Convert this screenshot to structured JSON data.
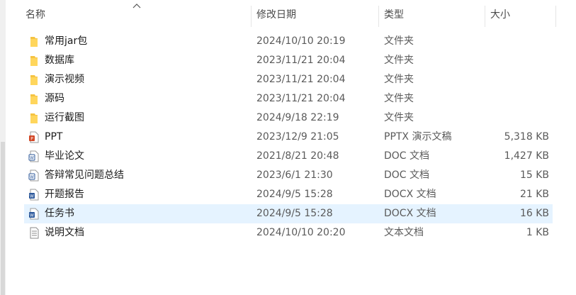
{
  "columns": {
    "name": "名称",
    "modified": "修改日期",
    "type": "类型",
    "size": "大小"
  },
  "files": [
    {
      "name": "常用jar包",
      "modified": "2024/10/10 20:19",
      "type": "文件夹",
      "size": "",
      "icon": "folder-icon"
    },
    {
      "name": "数据库",
      "modified": "2023/11/21 20:04",
      "type": "文件夹",
      "size": "",
      "icon": "folder-icon"
    },
    {
      "name": "演示视频",
      "modified": "2023/11/21 20:04",
      "type": "文件夹",
      "size": "",
      "icon": "folder-icon"
    },
    {
      "name": "源码",
      "modified": "2023/11/21 20:04",
      "type": "文件夹",
      "size": "",
      "icon": "folder-icon"
    },
    {
      "name": "运行截图",
      "modified": "2024/9/18 22:19",
      "type": "文件夹",
      "size": "",
      "icon": "folder-icon"
    },
    {
      "name": "PPT",
      "modified": "2023/12/9 21:05",
      "type": "PPTX 演示文稿",
      "size": "5,318 KB",
      "icon": "pptx-file-icon"
    },
    {
      "name": "毕业论文",
      "modified": "2021/8/21 20:48",
      "type": "DOC 文档",
      "size": "1,427 KB",
      "icon": "doc-file-icon"
    },
    {
      "name": "答辩常见问题总结",
      "modified": "2023/6/1 21:30",
      "type": "DOC 文档",
      "size": "15 KB",
      "icon": "doc-file-icon"
    },
    {
      "name": "开题报告",
      "modified": "2024/9/5 15:28",
      "type": "DOCX 文档",
      "size": "21 KB",
      "icon": "docx-file-icon"
    },
    {
      "name": "任务书",
      "modified": "2024/9/5 15:28",
      "type": "DOCX 文档",
      "size": "16 KB",
      "icon": "docx-file-icon",
      "selected": true
    },
    {
      "name": "说明文档",
      "modified": "2024/10/10 20:20",
      "type": "文本文档",
      "size": "1 KB",
      "icon": "text-file-icon"
    }
  ],
  "colors": {
    "selected_row": "#e5f3ff",
    "folder": "#f5c342",
    "ppt": "#d24726",
    "word": "#2b579a"
  }
}
